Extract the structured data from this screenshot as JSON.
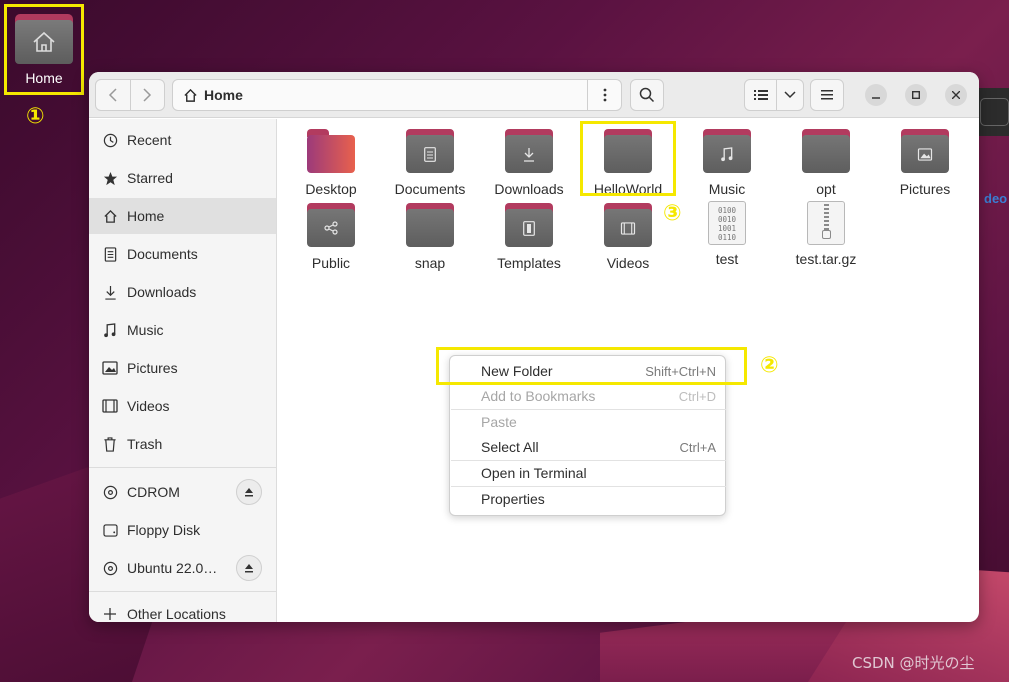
{
  "desktop": {
    "home_icon_label": "Home",
    "annotation_1": "①",
    "annotation_2": "②",
    "annotation_3": "③",
    "background_text": "deo",
    "watermark": "CSDN @时光の尘"
  },
  "headerbar": {
    "back_icon": "chevron-left-icon",
    "forward_icon": "chevron-right-icon",
    "path_icon": "home-icon",
    "path_label": "Home",
    "search_icon": "search-icon",
    "view_icon": "list-view-icon",
    "menu_icon": "hamburger-icon"
  },
  "sidebar": {
    "items": [
      {
        "label": "Recent",
        "icon": "clock-icon"
      },
      {
        "label": "Starred",
        "icon": "star-icon"
      },
      {
        "label": "Home",
        "icon": "home-icon",
        "active": true
      },
      {
        "label": "Documents",
        "icon": "document-icon"
      },
      {
        "label": "Downloads",
        "icon": "download-icon"
      },
      {
        "label": "Music",
        "icon": "music-icon"
      },
      {
        "label": "Pictures",
        "icon": "picture-icon"
      },
      {
        "label": "Videos",
        "icon": "film-icon"
      },
      {
        "label": "Trash",
        "icon": "trash-icon"
      }
    ],
    "devices": [
      {
        "label": "CDROM",
        "icon": "disc-icon",
        "eject": true
      },
      {
        "label": "Floppy Disk",
        "icon": "drive-icon",
        "eject": false
      },
      {
        "label": "Ubuntu 22.0…",
        "icon": "disc-icon",
        "eject": true
      }
    ],
    "other_locations": "Other Locations"
  },
  "files": [
    {
      "name": "Desktop"
    },
    {
      "name": "Documents"
    },
    {
      "name": "Downloads"
    },
    {
      "name": "HelloWorld"
    },
    {
      "name": "Music"
    },
    {
      "name": "opt"
    },
    {
      "name": "Pictures"
    },
    {
      "name": "Public"
    },
    {
      "name": "snap"
    },
    {
      "name": "Templates"
    },
    {
      "name": "Videos"
    },
    {
      "name": "test",
      "binary_text": "0100 0010 1001 0110"
    },
    {
      "name": "test.tar.gz"
    }
  ],
  "context_menu": {
    "items": [
      {
        "label": "New Folder",
        "accel": "Shift+Ctrl+N",
        "enabled": true
      },
      {
        "label": "Add to Bookmarks",
        "accel": "Ctrl+D",
        "enabled": false
      },
      {
        "label": "Paste",
        "accel": "",
        "enabled": false
      },
      {
        "label": "Select All",
        "accel": "Ctrl+A",
        "enabled": true
      },
      {
        "label": "Open in Terminal",
        "accel": "",
        "enabled": true
      },
      {
        "label": "Properties",
        "accel": "",
        "enabled": true
      }
    ]
  },
  "colors": {
    "highlight": "#f5e800",
    "folder_tab": "#b23b5f",
    "folder_body": "#6a6a6a"
  }
}
